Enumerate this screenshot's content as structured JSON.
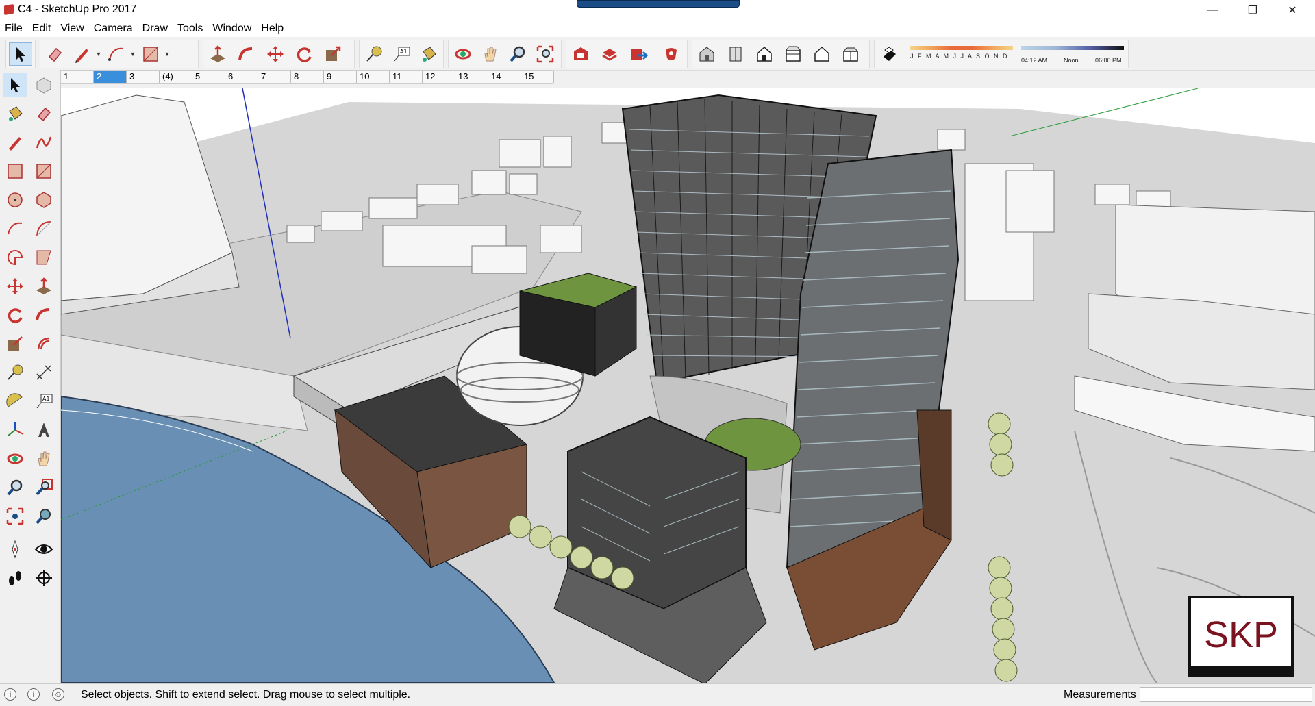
{
  "window": {
    "title": "C4 - SketchUp Pro 2017",
    "minimize": "—",
    "maximize": "❐",
    "close": "✕"
  },
  "menu": [
    "File",
    "Edit",
    "View",
    "Camera",
    "Draw",
    "Tools",
    "Window",
    "Help"
  ],
  "scenes": {
    "tabs": [
      "1",
      "2",
      "3",
      "(4)",
      "5",
      "6",
      "7",
      "8",
      "9",
      "10",
      "11",
      "12",
      "13",
      "14",
      "15"
    ],
    "active_index": 1
  },
  "shadows": {
    "months": "J F M A M J J A S O N D",
    "time_start": "04:12 AM",
    "time_mid": "Noon",
    "time_end": "06:00 PM"
  },
  "status": {
    "hint": "Select objects. Shift to extend select. Drag mouse to select multiple.",
    "measurements_label": "Measurements",
    "measurements_value": ""
  },
  "logo_text": "SKP",
  "colors": {
    "accent_red": "#c8342f",
    "water": "#6a8fb5",
    "grass": "#6f9440",
    "logo_red": "#7a1220",
    "selected_tab": "#3a8fdc"
  }
}
